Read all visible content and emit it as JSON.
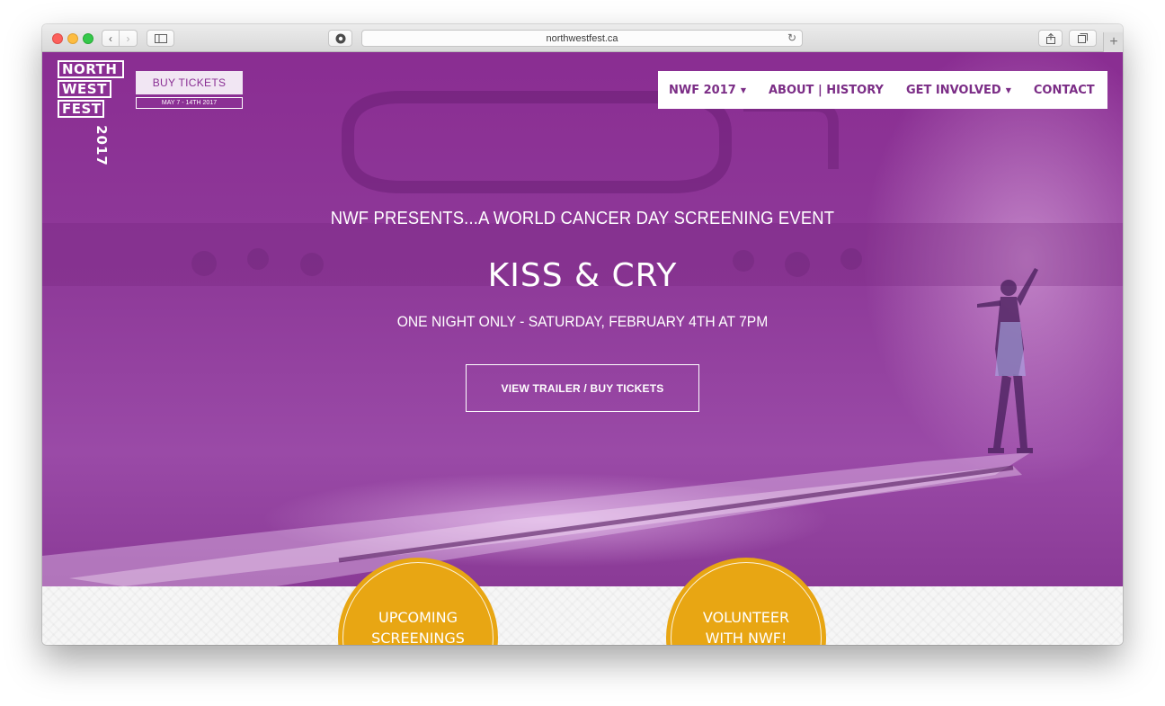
{
  "browser": {
    "url": "northwestfest.ca",
    "icons": {
      "back": "chevron-left-icon",
      "forward": "chevron-right-icon",
      "sidebar": "sidebar-icon",
      "extension": "extension-icon",
      "reload": "reload-icon",
      "share": "share-icon",
      "tabs": "tabs-icon",
      "new_tab": "plus-icon"
    }
  },
  "header": {
    "logo": {
      "line1": "NORTH",
      "line2": "WEST",
      "line3": "FEST",
      "year": "2017"
    },
    "buy_tickets_label": "BUY TICKETS",
    "festival_dates": "MAY 7 - 14TH 2017"
  },
  "nav": {
    "items": [
      {
        "label": "NWF 2017",
        "has_dropdown": true
      },
      {
        "label": "ABOUT | HISTORY",
        "has_dropdown": false
      },
      {
        "label": "GET INVOLVED",
        "has_dropdown": true
      },
      {
        "label": "CONTACT",
        "has_dropdown": false
      }
    ],
    "dropdown_glyph": "▼"
  },
  "hero": {
    "kicker": "NWF PRESENTS...A WORLD CANCER DAY SCREENING EVENT",
    "title": "KISS & CRY",
    "subtitle": "ONE NIGHT ONLY - SATURDAY, FEBRUARY 4TH AT 7PM",
    "cta_label": "VIEW TRAILER / BUY TICKETS"
  },
  "features": [
    {
      "line1": "UPCOMING",
      "line2": "SCREENINGS"
    },
    {
      "line1": "VOLUNTEER",
      "line2": "WITH NWF!"
    }
  ],
  "colors": {
    "brand_purple": "#8a2d92",
    "nav_text": "#7b2d86",
    "feature_gold": "#e8a613"
  }
}
